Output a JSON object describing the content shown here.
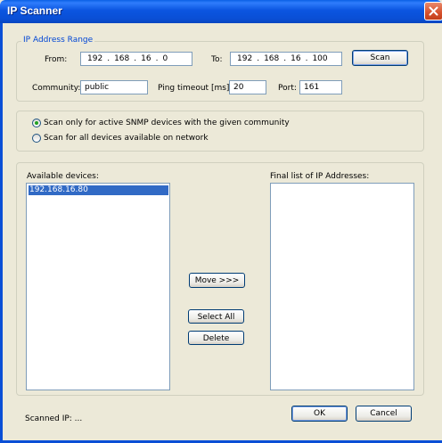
{
  "window": {
    "title": "IP Scanner"
  },
  "range": {
    "legend": "IP Address Range",
    "from_label": "From:",
    "from_ip": [
      "192",
      "168",
      "16",
      "0"
    ],
    "to_label": "To:",
    "to_ip": [
      "192",
      "168",
      "16",
      "100"
    ],
    "scan_label": "Scan"
  },
  "options": {
    "community_label": "Community:",
    "community_value": "public",
    "ping_label": "Ping timeout [ms]:",
    "ping_value": "20",
    "port_label": "Port:",
    "port_value": "161"
  },
  "scan_mode": {
    "option_snmp": "Scan only for active SNMP devices with the given community",
    "option_all": "Scan for all devices available on network",
    "selected": "snmp"
  },
  "devices": {
    "available_label": "Available devices:",
    "available_items": [
      "192.168.16.80"
    ],
    "final_label": "Final list of IP Addresses:",
    "final_items": []
  },
  "actions": {
    "move_label": "Move >>>",
    "select_all_label": "Select All",
    "delete_label": "Delete"
  },
  "footer": {
    "status": "Scanned IP: ...",
    "ok_label": "OK",
    "cancel_label": "Cancel"
  }
}
